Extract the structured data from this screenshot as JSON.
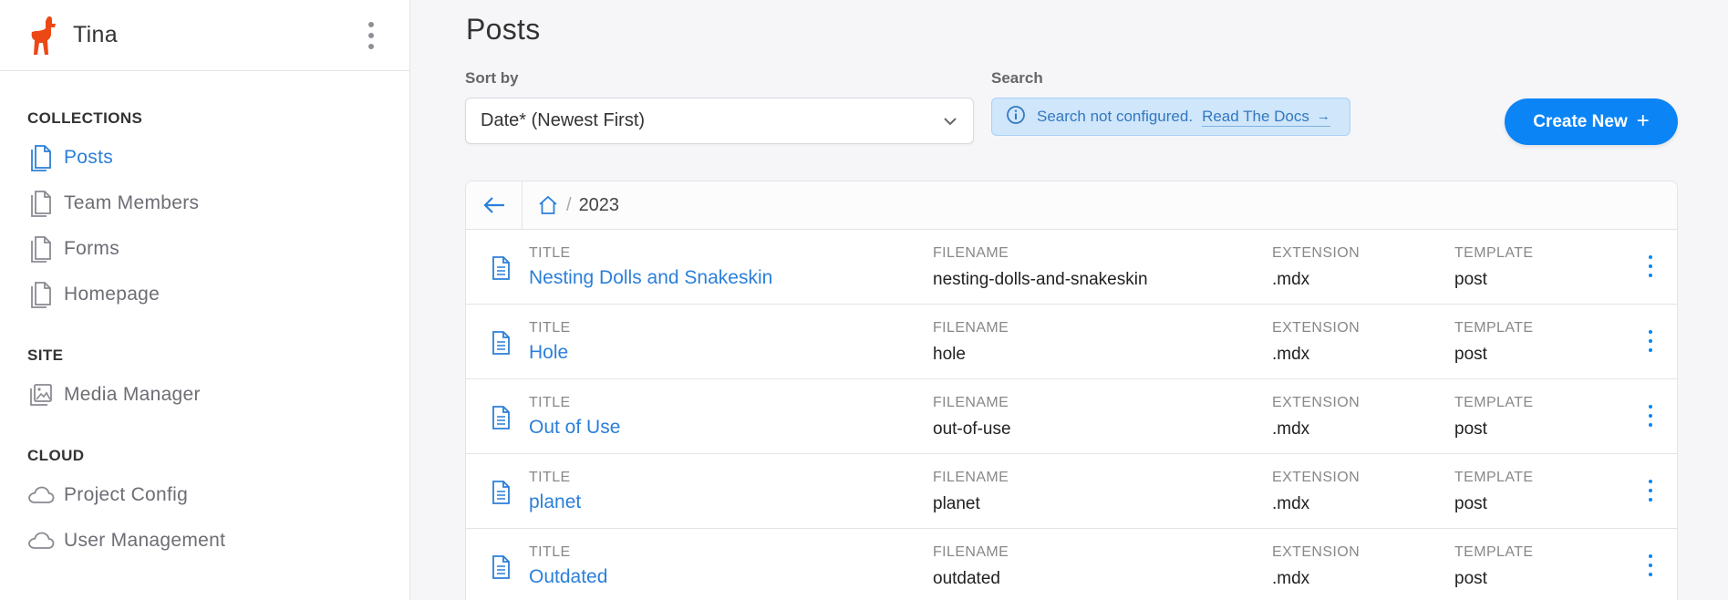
{
  "app": {
    "name": "Tina"
  },
  "sidebar": {
    "sections": [
      {
        "title": "COLLECTIONS"
      },
      {
        "title": "SITE"
      },
      {
        "title": "CLOUD"
      }
    ],
    "items": [
      {
        "label": "Posts",
        "icon": "document-icon",
        "active": true
      },
      {
        "label": "Team Members",
        "icon": "document-icon"
      },
      {
        "label": "Forms",
        "icon": "document-icon"
      },
      {
        "label": "Homepage",
        "icon": "document-icon"
      },
      {
        "label": "Media Manager",
        "icon": "images-icon"
      },
      {
        "label": "Project Config",
        "icon": "cloud-icon"
      },
      {
        "label": "User Management",
        "icon": "cloud-icon"
      }
    ]
  },
  "main": {
    "title": "Posts",
    "sort": {
      "label": "Sort by",
      "value": "Date* (Newest First)"
    },
    "search": {
      "label": "Search",
      "message": "Search not configured.",
      "link": "Read The Docs",
      "link_arrow": "→"
    },
    "create_button": "Create New",
    "create_plus": "+",
    "breadcrumb": {
      "separator": "/",
      "folder": "2023"
    },
    "columns": {
      "title": "TITLE",
      "filename": "FILENAME",
      "extension": "EXTENSION",
      "template": "TEMPLATE"
    },
    "rows": [
      {
        "title": "Nesting Dolls and Snakeskin",
        "filename": "nesting-dolls-and-snakeskin",
        "extension": ".mdx",
        "template": "post"
      },
      {
        "title": "Hole",
        "filename": "hole",
        "extension": ".mdx",
        "template": "post"
      },
      {
        "title": "Out of Use",
        "filename": "out-of-use",
        "extension": ".mdx",
        "template": "post"
      },
      {
        "title": "planet",
        "filename": "planet",
        "extension": ".mdx",
        "template": "post"
      },
      {
        "title": "Outdated",
        "filename": "outdated",
        "extension": ".mdx",
        "template": "post"
      }
    ]
  },
  "colors": {
    "accent": "#0b84f5",
    "link": "#2b7fd9",
    "brand": "#ec4815",
    "alert_bg": "#cfe6fb"
  }
}
